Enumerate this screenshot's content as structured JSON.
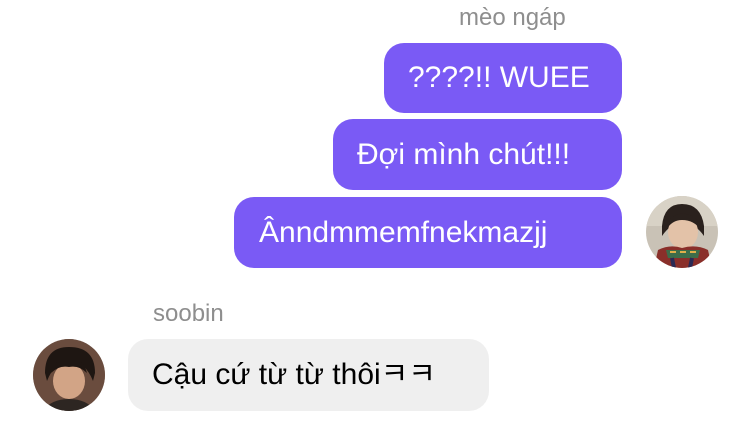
{
  "conversation": {
    "outgoing_sender": "mèo ngáp",
    "outgoing_messages": [
      {
        "text": "????!! WUEE"
      },
      {
        "text": "Đợi mình chút!!!"
      },
      {
        "text": "Ânndmmemfnekmazjj"
      }
    ],
    "incoming_sender": "soobin",
    "incoming_messages": [
      {
        "text": "Cậu cứ từ từ thôiㅋㅋ"
      }
    ]
  },
  "colors": {
    "outgoing_bubble": "#7a5af5",
    "incoming_bubble": "#efefef",
    "sender_name": "#8e8e8e"
  }
}
